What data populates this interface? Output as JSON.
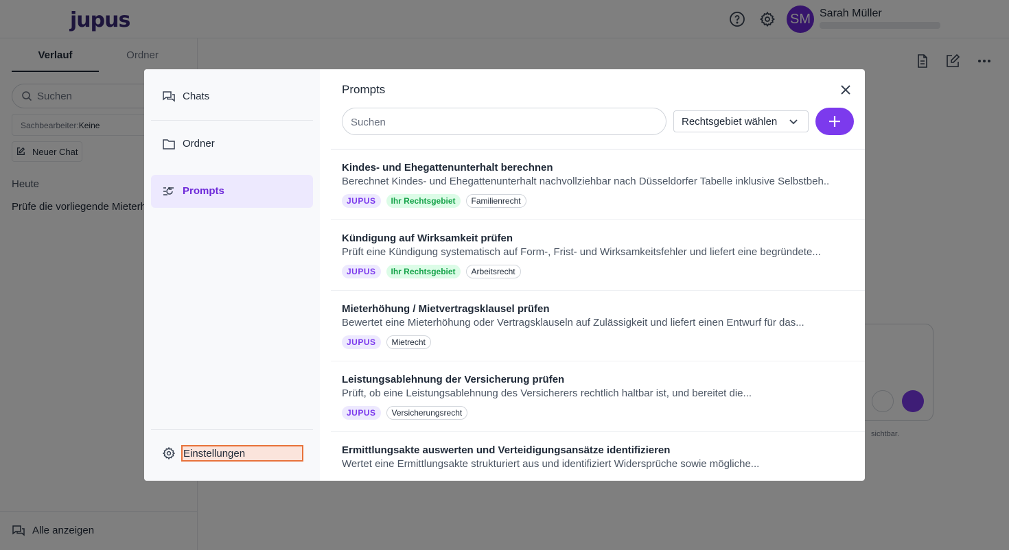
{
  "app": {
    "logo": "jupus",
    "user_initials": "SM",
    "user_name": "Sarah Müller"
  },
  "sidebar": {
    "tabs": [
      "Verlauf",
      "Ordner"
    ],
    "search_placeholder": "Suchen",
    "filter_label": "Sachbearbeiter:",
    "filter_value": "Keine",
    "new_chat": "Neuer Chat",
    "section_today": "Heute",
    "chat_item": "Prüfe die vorliegende Mieterh",
    "show_all": "Alle anzeigen"
  },
  "composer": {
    "hint": "sichtbar."
  },
  "modal": {
    "nav": {
      "chats": "Chats",
      "folders": "Ordner",
      "prompts": "Prompts",
      "settings": "Einstellungen"
    },
    "title": "Prompts",
    "search_placeholder": "Suchen",
    "area_select": "Rechtsgebiet wählen",
    "prompts": [
      {
        "title": "Kindes- und Ehegattenunterhalt berechnen",
        "description": "Berechnet Kindes- und Ehegattenunterhalt nachvollziehbar nach Düsseldorfer Tabelle inklusive Selbstbeh...",
        "tags": [
          "JUPUS",
          "Ihr Rechtsgebiet",
          "Familienrecht"
        ]
      },
      {
        "title": "Kündigung auf Wirksamkeit prüfen",
        "description": "Prüft eine Kündigung systematisch auf Form-, Frist- und Wirksamkeitsfehler und liefert eine begründete...",
        "tags": [
          "JUPUS",
          "Ihr Rechtsgebiet",
          "Arbeitsrecht"
        ]
      },
      {
        "title": "Mieterhöhung / Mietvertragsklausel prüfen",
        "description": "Bewertet eine Mieterhöhung oder Vertragsklauseln auf Zulässigkeit und liefert einen Entwurf für das...",
        "tags": [
          "JUPUS",
          "Mietrecht"
        ]
      },
      {
        "title": "Leistungsablehnung der Versicherung prüfen",
        "description": "Prüft, ob eine Leistungsablehnung des Versicherers rechtlich haltbar ist, und bereitet die...",
        "tags": [
          "JUPUS",
          "Versicherungsrecht"
        ]
      },
      {
        "title": "Ermittlungsakte auswerten und Verteidigungsansätze identifizieren",
        "description": "Wertet eine Ermittlungsakte strukturiert aus und identifiziert Widersprüche sowie mögliche...",
        "tags": []
      }
    ]
  }
}
